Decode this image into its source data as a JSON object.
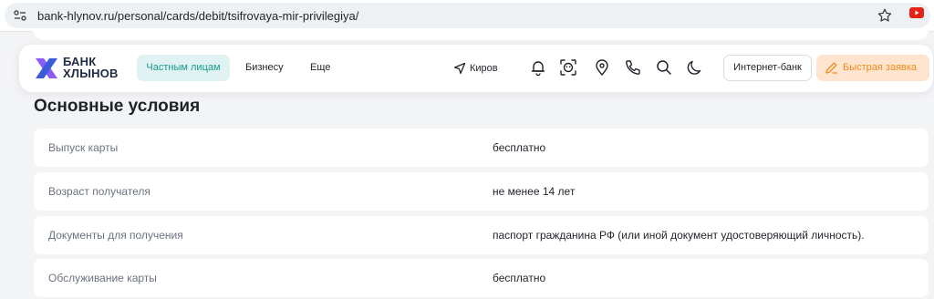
{
  "browser": {
    "url": "bank-hlynov.ru/personal/cards/debit/tsifrovaya-mir-privilegiya/"
  },
  "header": {
    "logo_line1": "БАНК",
    "logo_line2": "ХЛЫНОВ",
    "nav": [
      "Частным лицам",
      "Бизнесу",
      "Еще"
    ],
    "city": "Киров",
    "internet_bank_label": "Интернет-банк",
    "quick_request_label": "Быстрая заявка",
    "icons": [
      "bell-icon",
      "face-scan-icon",
      "location-pin-icon",
      "phone-icon",
      "search-icon",
      "moon-icon"
    ]
  },
  "main": {
    "section_title": "Основные условия",
    "conditions": [
      {
        "label": "Выпуск карты",
        "value": "бесплатно"
      },
      {
        "label": "Возраст получателя",
        "value": "не менее 14 лет"
      },
      {
        "label": "Документы для получения",
        "value": "паспорт гражданина РФ (или иной документ удостоверяющий личность)."
      },
      {
        "label": "Обслуживание карты",
        "value": "бесплатно"
      }
    ]
  },
  "colors": {
    "accent_teal": "#179a8c",
    "accent_teal_bg": "#e0f2f1",
    "quick_orange": "#f08a1d",
    "quick_orange_bg": "#ffe5cf",
    "logo_blue": "#3b5bdb",
    "logo_violet": "#8b5cf6"
  }
}
